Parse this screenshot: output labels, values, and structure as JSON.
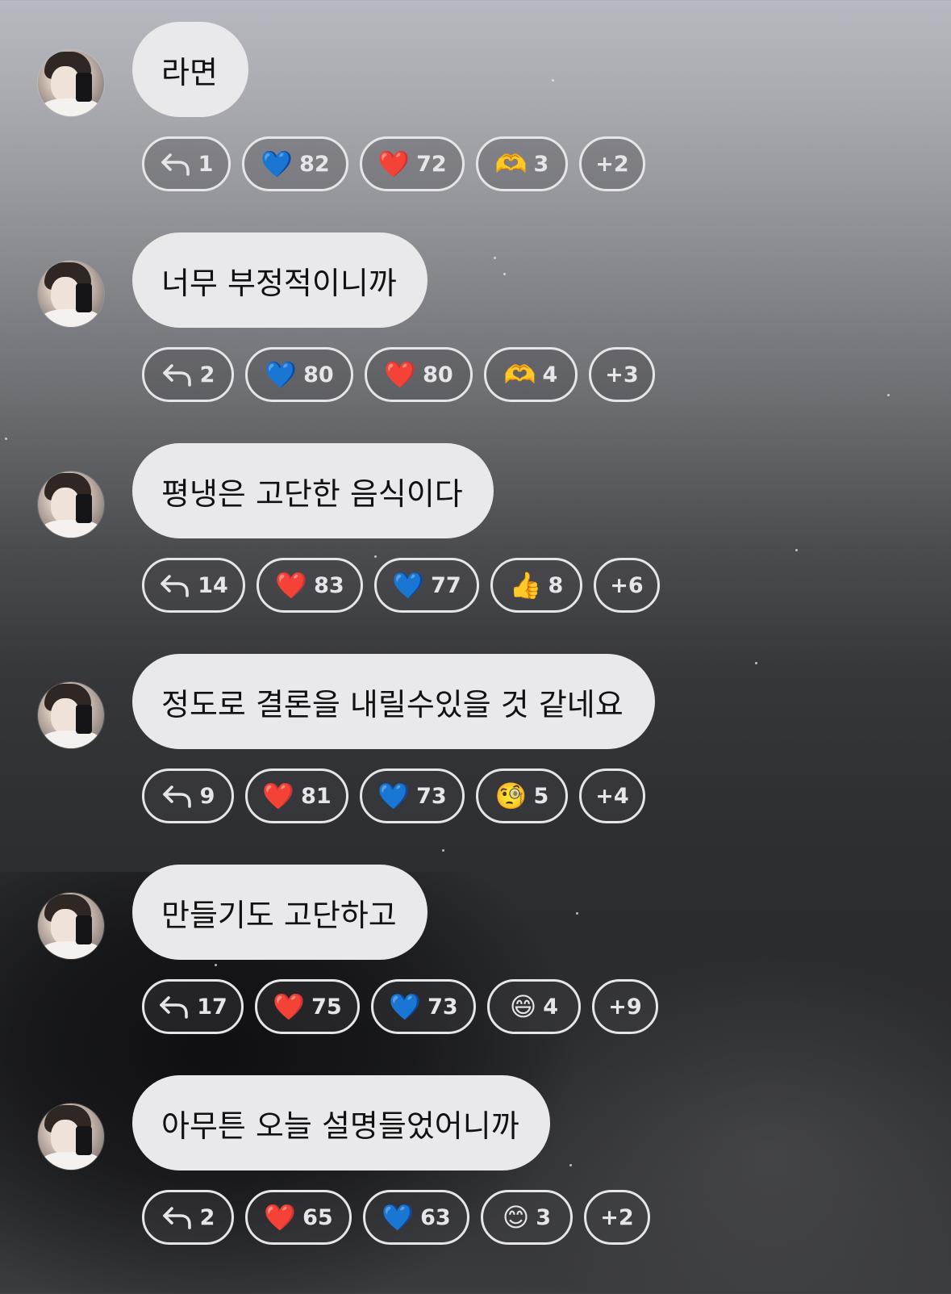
{
  "messages": [
    {
      "text": "라면",
      "reactions": [
        {
          "icon": "reply-icon",
          "count": "1"
        },
        {
          "icon": "blue-heart",
          "emoji": "💙",
          "count": "82"
        },
        {
          "icon": "red-heart",
          "emoji": "❤️",
          "count": "72"
        },
        {
          "icon": "heart-hands",
          "emoji": "🫶",
          "count": "3"
        },
        {
          "icon": "more",
          "count": "+2"
        }
      ]
    },
    {
      "text": "너무 부정적이니까",
      "reactions": [
        {
          "icon": "reply-icon",
          "count": "2"
        },
        {
          "icon": "blue-heart",
          "emoji": "💙",
          "count": "80"
        },
        {
          "icon": "red-heart",
          "emoji": "❤️",
          "count": "80"
        },
        {
          "icon": "heart-hands",
          "emoji": "🫶",
          "count": "4"
        },
        {
          "icon": "more",
          "count": "+3"
        }
      ]
    },
    {
      "text": "평냉은 고단한 음식이다",
      "reactions": [
        {
          "icon": "reply-icon",
          "count": "14"
        },
        {
          "icon": "red-heart",
          "emoji": "❤️",
          "count": "83"
        },
        {
          "icon": "blue-heart",
          "emoji": "💙",
          "count": "77"
        },
        {
          "icon": "thumbs-up",
          "emoji": "👍",
          "count": "8"
        },
        {
          "icon": "more",
          "count": "+6"
        }
      ]
    },
    {
      "text": "정도로 결론을 내릴수있을 것 같네요",
      "reactions": [
        {
          "icon": "reply-icon",
          "count": "9"
        },
        {
          "icon": "red-heart",
          "emoji": "❤️",
          "count": "81"
        },
        {
          "icon": "blue-heart",
          "emoji": "💙",
          "count": "73"
        },
        {
          "icon": "monocle-face",
          "emoji": "🧐",
          "count": "5"
        },
        {
          "icon": "more",
          "count": "+4"
        }
      ]
    },
    {
      "text": "만들기도 고단하고",
      "reactions": [
        {
          "icon": "reply-icon",
          "count": "17"
        },
        {
          "icon": "red-heart",
          "emoji": "❤️",
          "count": "75"
        },
        {
          "icon": "blue-heart",
          "emoji": "💙",
          "count": "73"
        },
        {
          "icon": "grinning-face",
          "emoji": "😄",
          "count": "4"
        },
        {
          "icon": "more",
          "count": "+9"
        }
      ]
    },
    {
      "text": "아무튼 오늘 설명들었어니까",
      "reactions": [
        {
          "icon": "reply-icon",
          "count": "2"
        },
        {
          "icon": "red-heart",
          "emoji": "❤️",
          "count": "65"
        },
        {
          "icon": "blue-heart",
          "emoji": "💙",
          "count": "63"
        },
        {
          "icon": "smiling-face",
          "emoji": "😊",
          "count": "3"
        },
        {
          "icon": "more",
          "count": "+2"
        }
      ]
    }
  ],
  "colors": {
    "bubble_bg": "#e9e9eb",
    "pill_border": "#e6e6ea",
    "red_heart": "#e0262b",
    "blue_heart": "#2f6ef0"
  }
}
